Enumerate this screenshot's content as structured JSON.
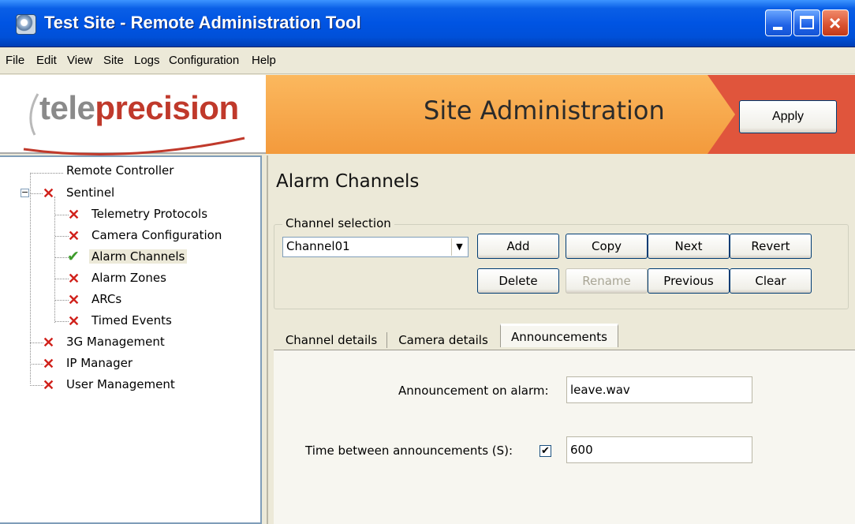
{
  "window": {
    "title": "Test Site - Remote Administration Tool"
  },
  "menu": [
    "File",
    "Edit",
    "View",
    "Site",
    "Logs",
    "Configuration",
    "Help"
  ],
  "banner": {
    "logo_part1": "tele",
    "logo_part2": "precision",
    "title": "Site Administration",
    "apply_label": "Apply"
  },
  "tree": {
    "remote_controller": "Remote Controller",
    "sentinel": "Sentinel",
    "telemetry": "Telemetry Protocols",
    "camera_config": "Camera Configuration",
    "alarm_channels": "Alarm Channels",
    "alarm_zones": "Alarm Zones",
    "arcs": "ARCs",
    "timed_events": "Timed Events",
    "g3_management": "3G Management",
    "ip_manager": "IP Manager",
    "user_management": "User Management",
    "expand_symbol": "−"
  },
  "main": {
    "title": "Alarm Channels",
    "channel_group_label": "Channel selection",
    "channel_value": "Channel01",
    "buttons": {
      "add": "Add",
      "copy": "Copy",
      "next": "Next",
      "revert": "Revert",
      "delete": "Delete",
      "rename": "Rename",
      "previous": "Previous",
      "clear": "Clear"
    },
    "tabs": {
      "channel_details": "Channel details",
      "camera_details": "Camera details",
      "announcements": "Announcements"
    },
    "announcement_label": "Announcement on alarm:",
    "announcement_value": "leave.wav",
    "time_label": "Time between announcements (S):",
    "time_enabled": true,
    "time_value": "600"
  },
  "colors": {
    "titlebar": "#0054e3",
    "banner_orange": "#f7a64b",
    "banner_red": "#e0553c",
    "error_red": "#d0211b",
    "ok_green": "#3d9b2b"
  }
}
